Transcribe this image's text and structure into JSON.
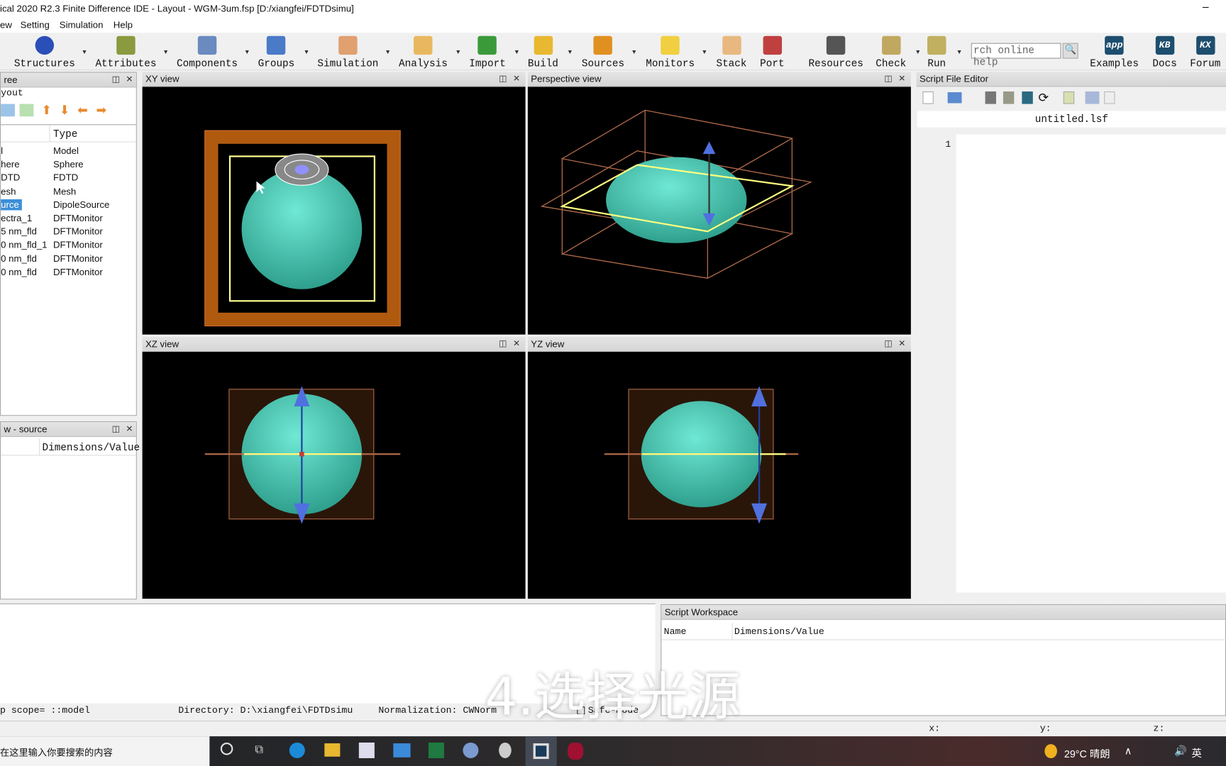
{
  "window": {
    "title": "ical 2020 R2.3 Finite Difference IDE - Layout - WGM-3um.fsp [D:/xiangfei/FDTDsimu]",
    "minimize": "–"
  },
  "menu": [
    "ew",
    "Setting",
    "Simulation",
    "Help"
  ],
  "toolbar": {
    "items": [
      {
        "label": "Structures",
        "icon": "sphere-icon",
        "color": "#2b4fb8"
      },
      {
        "label": "Attributes",
        "icon": "attributes-icon",
        "color": "#8a9a40"
      },
      {
        "label": "Components",
        "icon": "components-icon",
        "color": "#6a8ac0"
      },
      {
        "label": "Groups",
        "icon": "folder-icon",
        "color": "#4a7ac8"
      },
      {
        "label": "Simulation",
        "icon": "simulation-grid-icon",
        "color": "#e0a070"
      },
      {
        "label": "Analysis",
        "icon": "analysis-function-icon",
        "color": "#e8b860"
      },
      {
        "label": "Import",
        "icon": "gds-import-icon",
        "color": "#3a9a3a"
      },
      {
        "label": "Build",
        "icon": "build-layers-icon",
        "color": "#e8b830"
      },
      {
        "label": "Sources",
        "icon": "source-target-icon",
        "color": "#e09020"
      },
      {
        "label": "Monitors",
        "icon": "monitor-icon",
        "color": "#f0d040"
      },
      {
        "label": "Stack",
        "icon": "stack-icon",
        "color": "#e8b880"
      },
      {
        "label": "Port",
        "icon": "port-arrows-icon",
        "color": "#c04040"
      },
      {
        "label": "Resources",
        "icon": "resources-network-icon",
        "color": "#555"
      },
      {
        "label": "Check",
        "icon": "check-icon",
        "color": "#c0a860"
      },
      {
        "label": "Run",
        "icon": "run-icon",
        "color": "#c0b060"
      },
      {
        "label": "Examples",
        "icon": "app-icon",
        "color": "#1d4e6e",
        "glyph": "app"
      },
      {
        "label": "Docs",
        "icon": "kb-icon",
        "color": "#1d4e6e",
        "glyph": "KB"
      },
      {
        "label": "Forum",
        "icon": "kx-icon",
        "color": "#1d4e6e",
        "glyph": "KX"
      }
    ],
    "search_placeholder": "rch online help"
  },
  "object_tree": {
    "title": "ree",
    "root": "yout",
    "columns": [
      "",
      "Type"
    ],
    "rows": [
      {
        "name": "l",
        "type": "Model"
      },
      {
        "name": "here",
        "type": "Sphere"
      },
      {
        "name": "DTD",
        "type": "FDTD"
      },
      {
        "name": "esh",
        "type": "Mesh"
      },
      {
        "name": "urce",
        "type": "DipoleSource",
        "selected": true
      },
      {
        "name": "ectra_1",
        "type": "DFTMonitor"
      },
      {
        "name": "5 nm_fld",
        "type": "DFTMonitor"
      },
      {
        "name": "0 nm_fld_1",
        "type": "DFTMonitor"
      },
      {
        "name": "0 nm_fld",
        "type": "DFTMonitor"
      },
      {
        "name": "0 nm_fld",
        "type": "DFTMonitor"
      }
    ]
  },
  "property_view": {
    "title": "w - source",
    "col": "Dimensions/Value"
  },
  "views": {
    "xy": "XY view",
    "persp": "Perspective view",
    "xz": "XZ view",
    "yz": "YZ view"
  },
  "script_editor": {
    "title": "Script File Editor",
    "tab": "untitled.lsf",
    "line": "1"
  },
  "status": {
    "scope": "p scope= ::model",
    "directory": "Directory: D:\\xiangfei\\FDTDsimu",
    "normalization": "Normalization: CWNorm",
    "safe_mode": "Safe-mode"
  },
  "workspace": {
    "title": "Script Workspace",
    "cols": [
      "Name",
      "Dimensions/Value"
    ]
  },
  "coords": {
    "x": "x:",
    "y": "y:",
    "z": "z:"
  },
  "taskbar": {
    "search": "在这里输入你要搜索的内容",
    "weather": "29°C 晴朗",
    "ime": "英"
  },
  "overlay": {
    "subtitle": "4.选择光源"
  },
  "colors": {
    "selection": "#3c8fd8",
    "sphere": "#4fd0b8",
    "sim_region": "#b05a10",
    "monitor": "#ffff80"
  }
}
